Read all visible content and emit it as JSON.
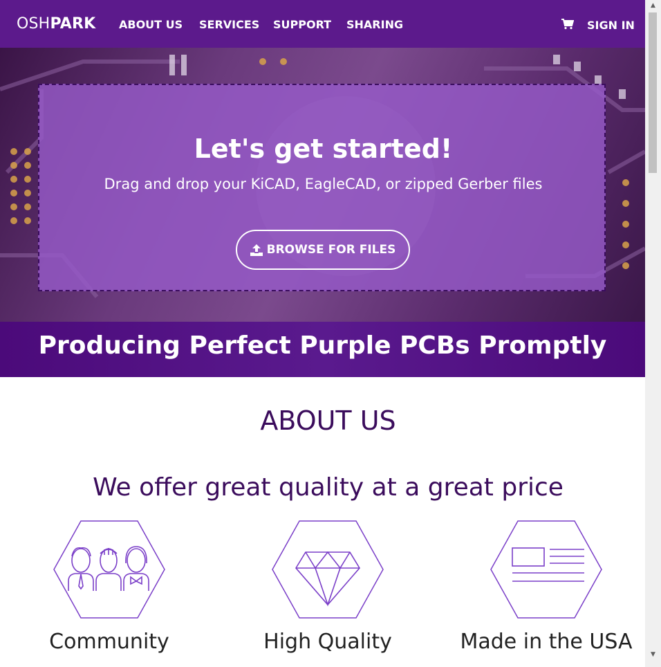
{
  "nav": {
    "logo_thin": "OSH",
    "logo_bold": "PARK",
    "links": [
      "ABOUT US",
      "SERVICES",
      "SUPPORT",
      "SHARING"
    ],
    "cart_icon": "shopping-cart-icon",
    "signin": "SIGN IN",
    "background": "#5c1a8c"
  },
  "hero": {
    "title": "Let's get started!",
    "subtitle": "Drag and drop your KiCAD, EagleCAD, or zipped Gerber files",
    "browse_button": "BROWSE FOR FILES",
    "browse_icon": "upload-icon",
    "overlay_color": "#965ac8"
  },
  "tagline": "Producing Perfect Purple PCBs Promptly",
  "about": {
    "title": "ABOUT US",
    "subtitle": "We offer great quality at a great price",
    "features": [
      {
        "label": "Community",
        "icon": "community-people-icon"
      },
      {
        "label": "High Quality",
        "icon": "diamond-icon"
      },
      {
        "label": "Made in the USA",
        "icon": "usa-flag-icon"
      }
    ],
    "accent": "#7a3ec8"
  }
}
